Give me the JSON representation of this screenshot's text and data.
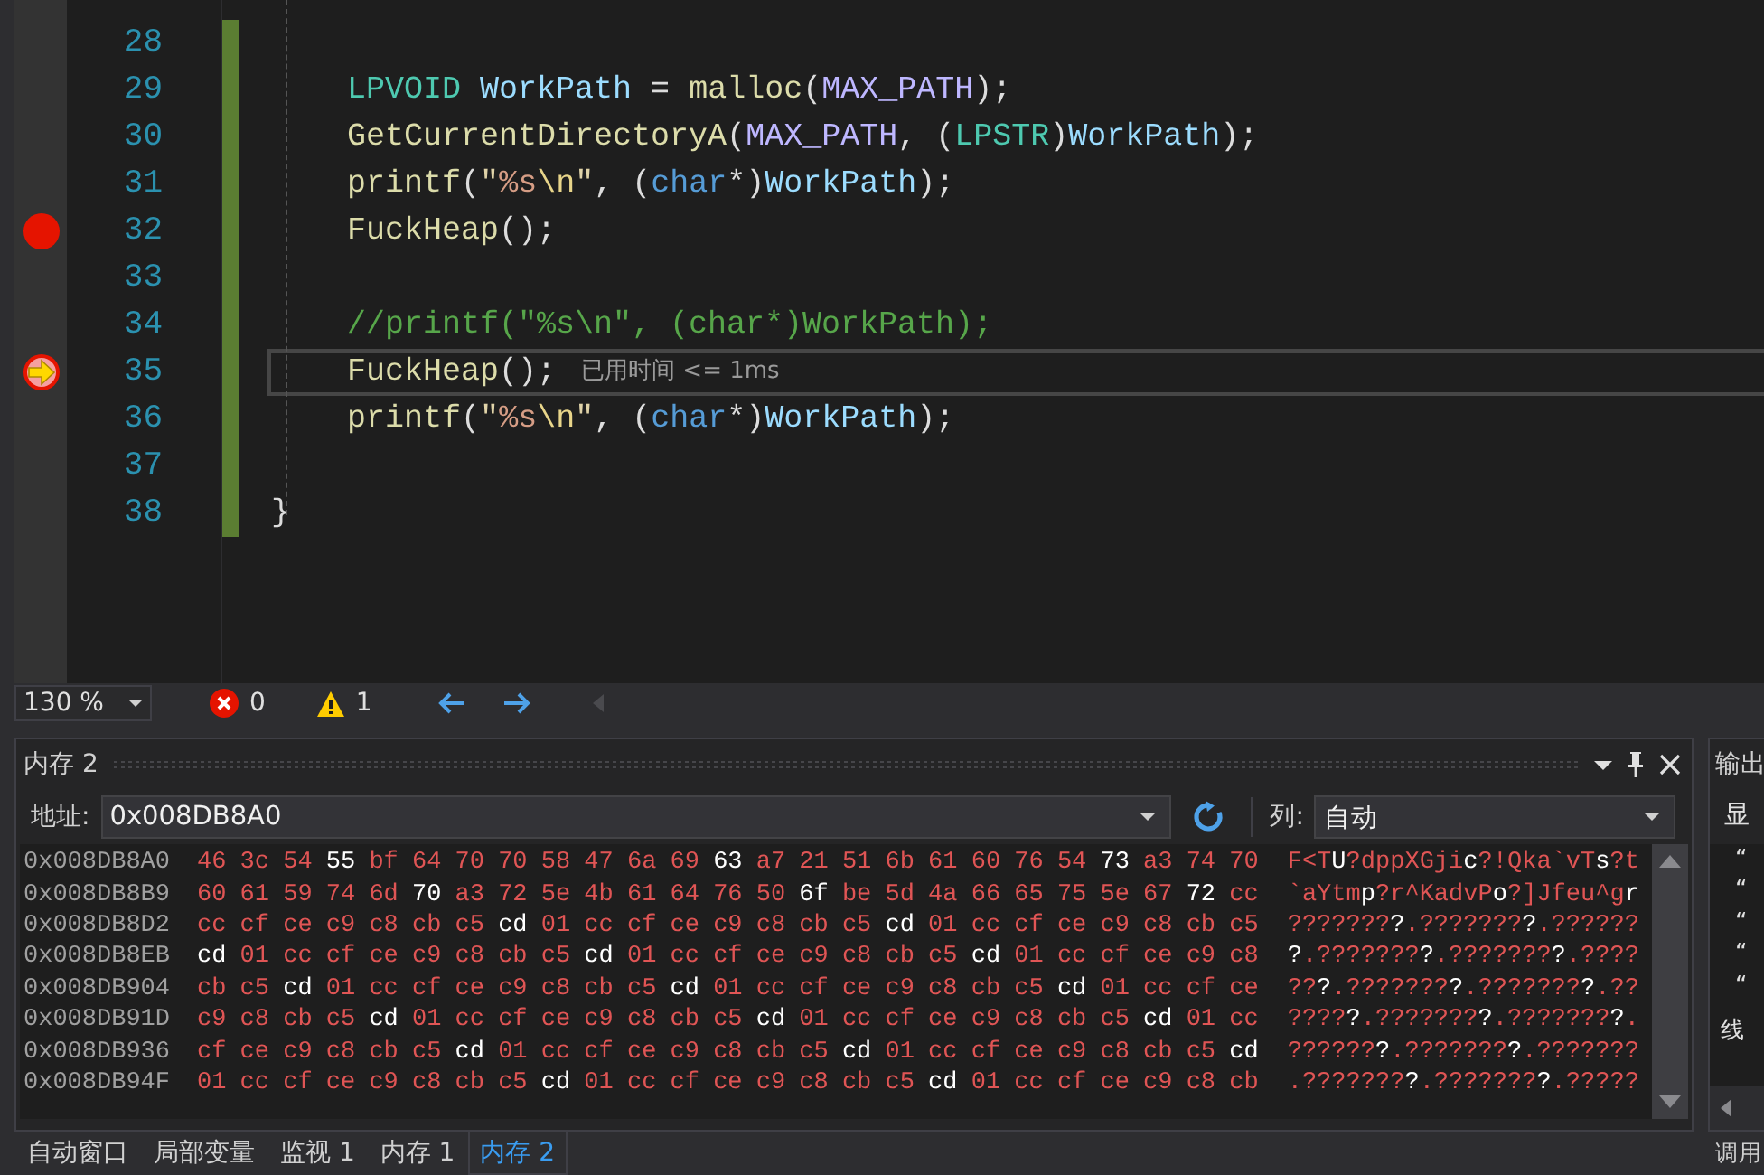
{
  "editor": {
    "lines": [
      {
        "number": "28",
        "changed": true,
        "current": false,
        "breakpoint": false
      },
      {
        "number": "29",
        "changed": true,
        "current": false,
        "breakpoint": false,
        "tokens": [
          {
            "kind": "type",
            "text": "    LPVOID"
          },
          {
            "kind": "var",
            "text": " WorkPath"
          },
          {
            "kind": "plain",
            "text": " = "
          },
          {
            "kind": "func",
            "text": "malloc"
          },
          {
            "kind": "plain",
            "text": "("
          },
          {
            "kind": "macro",
            "text": "MAX_PATH"
          },
          {
            "kind": "plain",
            "text": ");"
          }
        ]
      },
      {
        "number": "30",
        "changed": true,
        "current": false,
        "breakpoint": false,
        "tokens": [
          {
            "kind": "func",
            "text": "    GetCurrentDirectoryA"
          },
          {
            "kind": "plain",
            "text": "("
          },
          {
            "kind": "macro",
            "text": "MAX_PATH"
          },
          {
            "kind": "plain",
            "text": ", ("
          },
          {
            "kind": "type",
            "text": "LPSTR"
          },
          {
            "kind": "plain",
            "text": ")"
          },
          {
            "kind": "var",
            "text": "WorkPath"
          },
          {
            "kind": "plain",
            "text": ");"
          }
        ]
      },
      {
        "number": "31",
        "changed": true,
        "current": false,
        "breakpoint": false,
        "tokens": [
          {
            "kind": "func",
            "text": "    printf"
          },
          {
            "kind": "plain",
            "text": "("
          },
          {
            "kind": "string",
            "text": "\""
          },
          {
            "kind": "format",
            "text": "%s"
          },
          {
            "kind": "escape",
            "text": "\\n"
          },
          {
            "kind": "string",
            "text": "\""
          },
          {
            "kind": "plain",
            "text": ", ("
          },
          {
            "kind": "keyword",
            "text": "char"
          },
          {
            "kind": "plain",
            "text": "*)"
          },
          {
            "kind": "var",
            "text": "WorkPath"
          },
          {
            "kind": "plain",
            "text": ");"
          }
        ]
      },
      {
        "number": "32",
        "changed": true,
        "current": false,
        "breakpoint": true,
        "tokens": [
          {
            "kind": "func",
            "text": "    FuckHeap"
          },
          {
            "kind": "plain",
            "text": "();"
          }
        ]
      },
      {
        "number": "33",
        "changed": true,
        "current": false,
        "breakpoint": false
      },
      {
        "number": "34",
        "changed": true,
        "current": false,
        "breakpoint": false,
        "tokens": [
          {
            "kind": "comment",
            "text": "    //printf(\"%s\\n\", (char*)WorkPath);"
          }
        ]
      },
      {
        "number": "35",
        "changed": true,
        "current": true,
        "breakpoint": true,
        "tip": "已用时间 <= 1ms",
        "tokens": [
          {
            "kind": "func",
            "text": "    FuckHeap"
          },
          {
            "kind": "plain",
            "text": "();"
          }
        ]
      },
      {
        "number": "36",
        "changed": true,
        "current": false,
        "breakpoint": false,
        "tokens": [
          {
            "kind": "func",
            "text": "    printf"
          },
          {
            "kind": "plain",
            "text": "("
          },
          {
            "kind": "string",
            "text": "\""
          },
          {
            "kind": "format",
            "text": "%s"
          },
          {
            "kind": "escape",
            "text": "\\n"
          },
          {
            "kind": "string",
            "text": "\""
          },
          {
            "kind": "plain",
            "text": ", ("
          },
          {
            "kind": "keyword",
            "text": "char"
          },
          {
            "kind": "plain",
            "text": "*)"
          },
          {
            "kind": "var",
            "text": "WorkPath"
          },
          {
            "kind": "plain",
            "text": ");"
          }
        ]
      },
      {
        "number": "37",
        "changed": true,
        "current": false,
        "breakpoint": false
      },
      {
        "number": "38",
        "changed": true,
        "current": false,
        "breakpoint": false,
        "tokens": [
          {
            "kind": "plain",
            "text": "}"
          }
        ]
      }
    ]
  },
  "status_bar": {
    "zoom": "130 %",
    "errors": "0",
    "warnings": "1"
  },
  "memory": {
    "title": "内存 2",
    "address_label": "地址:",
    "address": "0x008DB8A0",
    "columns_label": "列:",
    "columns": "自动",
    "rows": [
      {
        "address": "0x008DB8A0",
        "ascii": "F<TU?dppXGjic?!Qka`vTs?t",
        "bytes": [
          {
            "v": "46",
            "changed": true
          },
          {
            "v": "3c",
            "changed": true
          },
          {
            "v": "54",
            "changed": true
          },
          {
            "v": "55",
            "changed": false
          },
          {
            "v": "bf",
            "changed": true
          },
          {
            "v": "64",
            "changed": true
          },
          {
            "v": "70",
            "changed": true
          },
          {
            "v": "70",
            "changed": true
          },
          {
            "v": "58",
            "changed": true
          },
          {
            "v": "47",
            "changed": true
          },
          {
            "v": "6a",
            "changed": true
          },
          {
            "v": "69",
            "changed": true
          },
          {
            "v": "63",
            "changed": false
          },
          {
            "v": "a7",
            "changed": true
          },
          {
            "v": "21",
            "changed": true
          },
          {
            "v": "51",
            "changed": true
          },
          {
            "v": "6b",
            "changed": true
          },
          {
            "v": "61",
            "changed": true
          },
          {
            "v": "60",
            "changed": true
          },
          {
            "v": "76",
            "changed": true
          },
          {
            "v": "54",
            "changed": true
          },
          {
            "v": "73",
            "changed": false
          },
          {
            "v": "a3",
            "changed": true
          },
          {
            "v": "74",
            "changed": true
          },
          {
            "v": "70",
            "changed": true
          }
        ]
      },
      {
        "address": "0x008DB8B9",
        "ascii": "`aYtmp?r^KadvPo?]Jfeu^gr",
        "bytes": [
          {
            "v": "60",
            "changed": true
          },
          {
            "v": "61",
            "changed": true
          },
          {
            "v": "59",
            "changed": true
          },
          {
            "v": "74",
            "changed": true
          },
          {
            "v": "6d",
            "changed": true
          },
          {
            "v": "70",
            "changed": false
          },
          {
            "v": "a3",
            "changed": true
          },
          {
            "v": "72",
            "changed": true
          },
          {
            "v": "5e",
            "changed": true
          },
          {
            "v": "4b",
            "changed": true
          },
          {
            "v": "61",
            "changed": true
          },
          {
            "v": "64",
            "changed": true
          },
          {
            "v": "76",
            "changed": true
          },
          {
            "v": "50",
            "changed": true
          },
          {
            "v": "6f",
            "changed": false
          },
          {
            "v": "be",
            "changed": true
          },
          {
            "v": "5d",
            "changed": true
          },
          {
            "v": "4a",
            "changed": true
          },
          {
            "v": "66",
            "changed": true
          },
          {
            "v": "65",
            "changed": true
          },
          {
            "v": "75",
            "changed": true
          },
          {
            "v": "5e",
            "changed": true
          },
          {
            "v": "67",
            "changed": true
          },
          {
            "v": "72",
            "changed": false
          },
          {
            "v": "cc",
            "changed": true
          }
        ]
      },
      {
        "address": "0x008DB8D2",
        "ascii": "????????.????????.??????",
        "bytes": [
          {
            "v": "cc",
            "changed": true
          },
          {
            "v": "cf",
            "changed": true
          },
          {
            "v": "ce",
            "changed": true
          },
          {
            "v": "c9",
            "changed": true
          },
          {
            "v": "c8",
            "changed": true
          },
          {
            "v": "cb",
            "changed": true
          },
          {
            "v": "c5",
            "changed": true
          },
          {
            "v": "cd",
            "changed": false
          },
          {
            "v": "01",
            "changed": true
          },
          {
            "v": "cc",
            "changed": true
          },
          {
            "v": "cf",
            "changed": true
          },
          {
            "v": "ce",
            "changed": true
          },
          {
            "v": "c9",
            "changed": true
          },
          {
            "v": "c8",
            "changed": true
          },
          {
            "v": "cb",
            "changed": true
          },
          {
            "v": "c5",
            "changed": true
          },
          {
            "v": "cd",
            "changed": false
          },
          {
            "v": "01",
            "changed": true
          },
          {
            "v": "cc",
            "changed": true
          },
          {
            "v": "cf",
            "changed": true
          },
          {
            "v": "ce",
            "changed": true
          },
          {
            "v": "c9",
            "changed": true
          },
          {
            "v": "c8",
            "changed": true
          },
          {
            "v": "cb",
            "changed": true
          },
          {
            "v": "c5",
            "changed": true
          }
        ]
      },
      {
        "address": "0x008DB8EB",
        "ascii": "?.????????.????????.????",
        "bytes": [
          {
            "v": "cd",
            "changed": false
          },
          {
            "v": "01",
            "changed": true
          },
          {
            "v": "cc",
            "changed": true
          },
          {
            "v": "cf",
            "changed": true
          },
          {
            "v": "ce",
            "changed": true
          },
          {
            "v": "c9",
            "changed": true
          },
          {
            "v": "c8",
            "changed": true
          },
          {
            "v": "cb",
            "changed": true
          },
          {
            "v": "c5",
            "changed": true
          },
          {
            "v": "cd",
            "changed": false
          },
          {
            "v": "01",
            "changed": true
          },
          {
            "v": "cc",
            "changed": true
          },
          {
            "v": "cf",
            "changed": true
          },
          {
            "v": "ce",
            "changed": true
          },
          {
            "v": "c9",
            "changed": true
          },
          {
            "v": "c8",
            "changed": true
          },
          {
            "v": "cb",
            "changed": true
          },
          {
            "v": "c5",
            "changed": true
          },
          {
            "v": "cd",
            "changed": false
          },
          {
            "v": "01",
            "changed": true
          },
          {
            "v": "cc",
            "changed": true
          },
          {
            "v": "cf",
            "changed": true
          },
          {
            "v": "ce",
            "changed": true
          },
          {
            "v": "c9",
            "changed": true
          },
          {
            "v": "c8",
            "changed": true
          }
        ]
      },
      {
        "address": "0x008DB904",
        "ascii": "???.????????.????????.??",
        "bytes": [
          {
            "v": "cb",
            "changed": true
          },
          {
            "v": "c5",
            "changed": true
          },
          {
            "v": "cd",
            "changed": false
          },
          {
            "v": "01",
            "changed": true
          },
          {
            "v": "cc",
            "changed": true
          },
          {
            "v": "cf",
            "changed": true
          },
          {
            "v": "ce",
            "changed": true
          },
          {
            "v": "c9",
            "changed": true
          },
          {
            "v": "c8",
            "changed": true
          },
          {
            "v": "cb",
            "changed": true
          },
          {
            "v": "c5",
            "changed": true
          },
          {
            "v": "cd",
            "changed": false
          },
          {
            "v": "01",
            "changed": true
          },
          {
            "v": "cc",
            "changed": true
          },
          {
            "v": "cf",
            "changed": true
          },
          {
            "v": "ce",
            "changed": true
          },
          {
            "v": "c9",
            "changed": true
          },
          {
            "v": "c8",
            "changed": true
          },
          {
            "v": "cb",
            "changed": true
          },
          {
            "v": "c5",
            "changed": true
          },
          {
            "v": "cd",
            "changed": false
          },
          {
            "v": "01",
            "changed": true
          },
          {
            "v": "cc",
            "changed": true
          },
          {
            "v": "cf",
            "changed": true
          },
          {
            "v": "ce",
            "changed": true
          }
        ]
      },
      {
        "address": "0x008DB91D",
        "ascii": "?????.????????.????????.",
        "bytes": [
          {
            "v": "c9",
            "changed": true
          },
          {
            "v": "c8",
            "changed": true
          },
          {
            "v": "cb",
            "changed": true
          },
          {
            "v": "c5",
            "changed": true
          },
          {
            "v": "cd",
            "changed": false
          },
          {
            "v": "01",
            "changed": true
          },
          {
            "v": "cc",
            "changed": true
          },
          {
            "v": "cf",
            "changed": true
          },
          {
            "v": "ce",
            "changed": true
          },
          {
            "v": "c9",
            "changed": true
          },
          {
            "v": "c8",
            "changed": true
          },
          {
            "v": "cb",
            "changed": true
          },
          {
            "v": "c5",
            "changed": true
          },
          {
            "v": "cd",
            "changed": false
          },
          {
            "v": "01",
            "changed": true
          },
          {
            "v": "cc",
            "changed": true
          },
          {
            "v": "cf",
            "changed": true
          },
          {
            "v": "ce",
            "changed": true
          },
          {
            "v": "c9",
            "changed": true
          },
          {
            "v": "c8",
            "changed": true
          },
          {
            "v": "cb",
            "changed": true
          },
          {
            "v": "c5",
            "changed": true
          },
          {
            "v": "cd",
            "changed": false
          },
          {
            "v": "01",
            "changed": true
          },
          {
            "v": "cc",
            "changed": true
          }
        ]
      },
      {
        "address": "0x008DB936",
        "ascii": "???????.????????.???????",
        "bytes": [
          {
            "v": "cf",
            "changed": true
          },
          {
            "v": "ce",
            "changed": true
          },
          {
            "v": "c9",
            "changed": true
          },
          {
            "v": "c8",
            "changed": true
          },
          {
            "v": "cb",
            "changed": true
          },
          {
            "v": "c5",
            "changed": true
          },
          {
            "v": "cd",
            "changed": false
          },
          {
            "v": "01",
            "changed": true
          },
          {
            "v": "cc",
            "changed": true
          },
          {
            "v": "cf",
            "changed": true
          },
          {
            "v": "ce",
            "changed": true
          },
          {
            "v": "c9",
            "changed": true
          },
          {
            "v": "c8",
            "changed": true
          },
          {
            "v": "cb",
            "changed": true
          },
          {
            "v": "c5",
            "changed": true
          },
          {
            "v": "cd",
            "changed": false
          },
          {
            "v": "01",
            "changed": true
          },
          {
            "v": "cc",
            "changed": true
          },
          {
            "v": "cf",
            "changed": true
          },
          {
            "v": "ce",
            "changed": true
          },
          {
            "v": "c9",
            "changed": true
          },
          {
            "v": "c8",
            "changed": true
          },
          {
            "v": "cb",
            "changed": true
          },
          {
            "v": "c5",
            "changed": true
          },
          {
            "v": "cd",
            "changed": false
          }
        ]
      },
      {
        "address": "0x008DB94F",
        "ascii": ".????????.????????.?????",
        "bytes": [
          {
            "v": "01",
            "changed": true
          },
          {
            "v": "cc",
            "changed": true
          },
          {
            "v": "cf",
            "changed": true
          },
          {
            "v": "ce",
            "changed": true
          },
          {
            "v": "c9",
            "changed": true
          },
          {
            "v": "c8",
            "changed": true
          },
          {
            "v": "cb",
            "changed": true
          },
          {
            "v": "c5",
            "changed": true
          },
          {
            "v": "cd",
            "changed": false
          },
          {
            "v": "01",
            "changed": true
          },
          {
            "v": "cc",
            "changed": true
          },
          {
            "v": "cf",
            "changed": true
          },
          {
            "v": "ce",
            "changed": true
          },
          {
            "v": "c9",
            "changed": true
          },
          {
            "v": "c8",
            "changed": true
          },
          {
            "v": "cb",
            "changed": true
          },
          {
            "v": "c5",
            "changed": true
          },
          {
            "v": "cd",
            "changed": false
          },
          {
            "v": "01",
            "changed": true
          },
          {
            "v": "cc",
            "changed": true
          },
          {
            "v": "cf",
            "changed": true
          },
          {
            "v": "ce",
            "changed": true
          },
          {
            "v": "c9",
            "changed": true
          },
          {
            "v": "c8",
            "changed": true
          },
          {
            "v": "cb",
            "changed": true
          }
        ]
      }
    ]
  },
  "output": {
    "title": "输出",
    "label": "显",
    "lines": [
      "“",
      "“",
      "“",
      "“",
      "“",
      "线"
    ]
  },
  "bottom_tabs": [
    {
      "label": "自动窗口",
      "selected": false
    },
    {
      "label": "局部变量",
      "selected": false
    },
    {
      "label": "监视 1",
      "selected": false
    },
    {
      "label": "内存 1",
      "selected": false
    },
    {
      "label": "内存 2",
      "selected": true
    }
  ],
  "right_tabs": [
    {
      "label": "调用",
      "selected": false
    }
  ]
}
